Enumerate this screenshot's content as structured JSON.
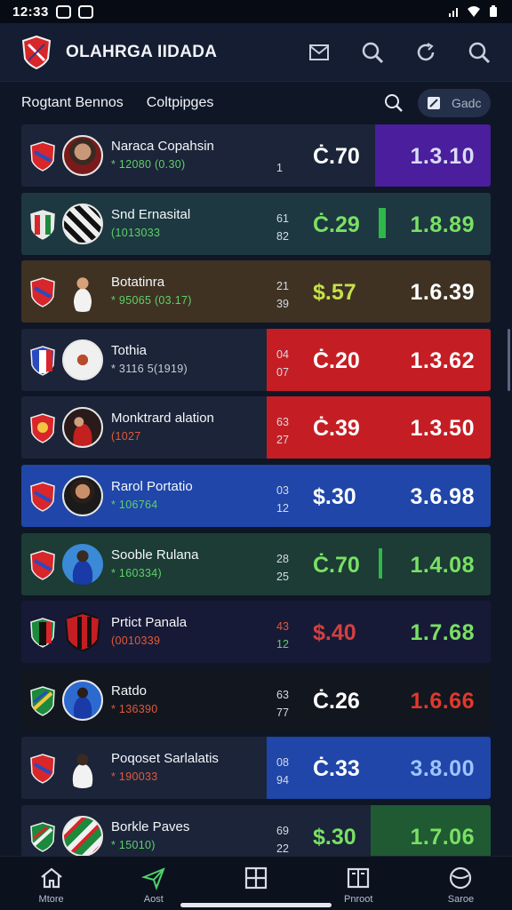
{
  "status": {
    "time": "12:33"
  },
  "app": {
    "title": "OLAHRGA IIDADA"
  },
  "subheader": {
    "tab1": "Rogtant Bennos",
    "tab2": "Coltpipges",
    "filter_label": "Gadc"
  },
  "colors": {
    "purple": "#4a1e9c",
    "red": "#c41e24",
    "blue": "#1f46a8",
    "green": "#2d7a3e",
    "gold_row": "#3f3222",
    "teal_row": "#1d3840",
    "green_row": "#1c3c35",
    "navy_row": "#171a36"
  },
  "rows": [
    {
      "name": "Naraca Copahsin",
      "sub": "* 12080 (0.30)",
      "stat_a": "",
      "stat_b": "1",
      "odd1": "Ċ.70",
      "odd2": "1.3.10",
      "sub_color": "#5fd06a",
      "odd1_color": "#ffffff",
      "odd2_color": "#d9dcf5"
    },
    {
      "name": "Snd Ernasital",
      "sub": "(1013033",
      "stat_a": "61",
      "stat_b": "82",
      "odd1": "Ċ.29",
      "odd2": "1.8.89",
      "sub_color": "#5fd06a",
      "odd1_color": "#79e064",
      "odd2_color": "#79e064"
    },
    {
      "name": "Botatinra",
      "sub": "* 95065 (03.17)",
      "stat_a": "21",
      "stat_b": "39",
      "odd1": "$.57",
      "odd2": "1.6.39",
      "sub_color": "#5fd06a",
      "odd1_color": "#c6e04a",
      "odd2_color": "#ffffff"
    },
    {
      "name": "Tothia",
      "sub": "* 3116 5(1919)",
      "stat_a": "04",
      "stat_b": "07",
      "odd1": "Ċ.20",
      "odd2": "1.3.62",
      "sub_color": "#c8cdd8",
      "odd1_color": "#ffffff",
      "odd2_color": "#ffffff"
    },
    {
      "name": "Monktrard alation",
      "sub": "(1027",
      "stat_a": "63",
      "stat_b": "27",
      "odd1": "Ċ.39",
      "odd2": "1.3.50",
      "sub_color": "#e05a3a",
      "odd1_color": "#ffffff",
      "odd2_color": "#ffffff"
    },
    {
      "name": "Rarol Portatio",
      "sub": "* 106764",
      "stat_a": "03",
      "stat_b": "12",
      "odd1": "$.30",
      "odd2": "3.6.98",
      "sub_color": "#5fd06a",
      "odd1_color": "#ffffff",
      "odd2_color": "#ffffff"
    },
    {
      "name": "Sooble Rulana",
      "sub": "* 160334)",
      "stat_a": "28",
      "stat_b": "25",
      "odd1": "Ċ.70",
      "odd2": "1.4.08",
      "sub_color": "#5fd06a",
      "odd1_color": "#79e064",
      "odd2_color": "#79e064"
    },
    {
      "name": "Prtict Panala",
      "sub": "(0010339",
      "stat_a": "43",
      "stat_b": "12",
      "odd1": "$.40",
      "odd2": "1.7.68",
      "sub_color": "#e05a3a",
      "odd1_color": "#d24040",
      "odd2_color": "#79e064"
    },
    {
      "name": "Ratdo",
      "sub": "* 136390",
      "stat_a": "63",
      "stat_b": "77",
      "odd1": "Ċ.26",
      "odd2": "1.6.66",
      "sub_color": "#e05a3a",
      "odd1_color": "#ffffff",
      "odd2_color": "#e0382c"
    },
    {
      "name": "Poqoset Sarlalatis",
      "sub": "* 190033",
      "stat_a": "08",
      "stat_b": "94",
      "odd1": "Ċ.33",
      "odd2": "3.8.00",
      "sub_color": "#e05a3a",
      "odd1_color": "#ffffff",
      "odd2_color": "#9ec4ff"
    },
    {
      "name": "Borkle Paves",
      "sub": "* 15010)",
      "stat_a": "69",
      "stat_b": "22",
      "odd1": "$.30",
      "odd2": "1.7.06",
      "sub_color": "#5fd06a",
      "odd1_color": "#79e064",
      "odd2_color": "#79e064"
    }
  ],
  "nav": [
    {
      "label": "Mtore",
      "icon": "home-icon"
    },
    {
      "label": "Aost",
      "icon": "send-icon"
    },
    {
      "label": "",
      "icon": "grid-icon"
    },
    {
      "label": "Pnroot",
      "icon": "book-icon"
    },
    {
      "label": "Saroe",
      "icon": "ball-icon"
    }
  ]
}
